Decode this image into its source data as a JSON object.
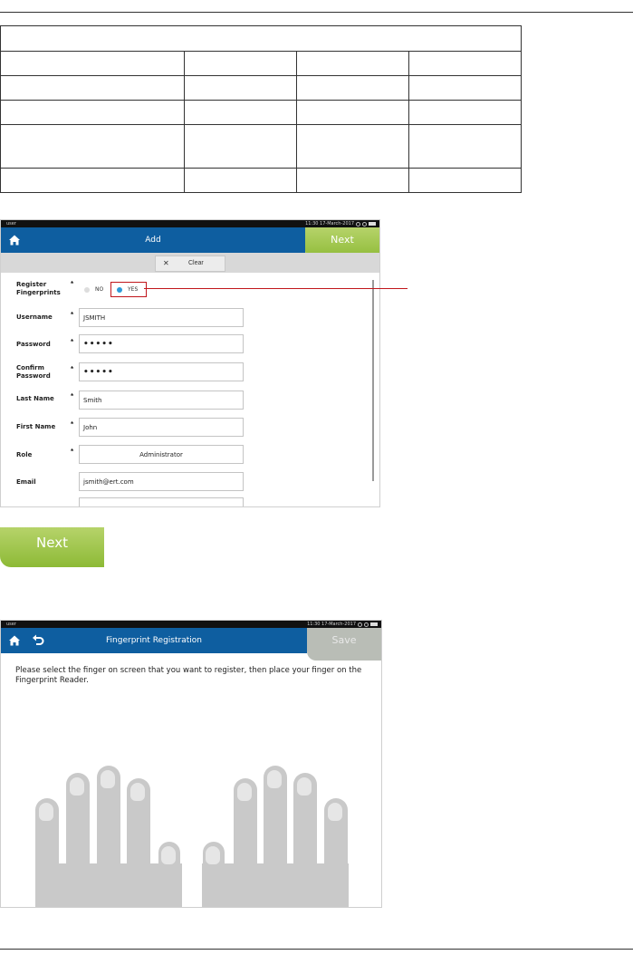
{
  "add_screen": {
    "status_user": "user",
    "status_time": "11:30 17-March-2017",
    "title": "Add",
    "next_label": "Next",
    "clear_label": "Clear",
    "fields": {
      "register_fingerprints_label": "Register Fingerprints",
      "radio_no": "NO",
      "radio_yes": "YES",
      "username_label": "Username",
      "username_value": "JSMITH",
      "password_label": "Password",
      "password_value": "•••••",
      "confirm_password_label": "Confirm Password",
      "confirm_password_value": "•••••",
      "last_name_label": "Last Name",
      "last_name_value": "Smith",
      "first_name_label": "First Name",
      "first_name_value": "John",
      "role_label": "Role",
      "role_value": "Administrator",
      "email_label": "Email",
      "email_value": "jsmith@ert.com"
    },
    "required_marker": "*",
    "selected_radio": "YES"
  },
  "standalone_next_label": "Next",
  "fingerprint_screen": {
    "status_user": "user",
    "status_time": "11:30 17-March-2017",
    "title": "Fingerprint Registration",
    "save_label": "Save",
    "instructions": "Please select the finger on screen that you want to register, then place your finger on the Fingerprint Reader."
  },
  "colors": {
    "titlebar": "#0e5ea0",
    "next_green": "#9cc445",
    "highlight_red": "#c0161c",
    "radio_blue": "#2d9ad8",
    "finger_gray": "#c9c9c9"
  },
  "icons": [
    "home-icon",
    "back-icon",
    "close-icon"
  ]
}
